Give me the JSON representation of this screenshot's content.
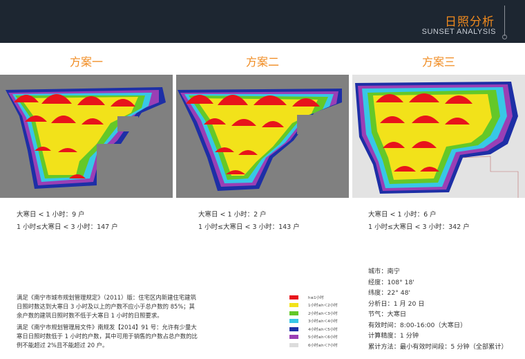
{
  "header": {
    "title": "日照分析",
    "subtitle": "SUNSET ANALYSIS"
  },
  "schemes": [
    {
      "title": "方案一",
      "stat_line1": "大寒日 < 1 小时：9 户",
      "stat_line2": "1 小时≤大寒日 < 3 小时：147 户"
    },
    {
      "title": "方案二",
      "stat_line1": "大寒日 < 1 小时：2 户",
      "stat_line2": "1 小时≤大寒日 < 3 小时：143 户"
    },
    {
      "title": "方案三",
      "stat_line1": "大寒日 < 1 小时：6 户",
      "stat_line2": "1 小时≤大寒日 < 3 小时：342 户"
    }
  ],
  "notes": {
    "para1": "满足《南宁市城市规划管理规定》（2011）版：住宅区内新建住宅建筑日照时数达到大寒日 3 小时及以上的户数不应小于总户数的 85%；其余户数的建筑日照时数不低于大寒日 1 小时的日照要求。",
    "para2": "满足《南宁市规划管理局文件》南规发【2014】91 号：允许有少量大寒日日照时数低于 1 小时的户数，其中可用于销售的户数占总户数的比例不能超过 2%且不能超过 20 户。"
  },
  "legend": [
    {
      "label": "h≤1小时",
      "color": "#e8141b"
    },
    {
      "label": "1小时≤h＜2小时",
      "color": "#f2e21a"
    },
    {
      "label": "2小时≤h＜3小时",
      "color": "#64c828"
    },
    {
      "label": "3小时≤h＜4小时",
      "color": "#38c7e6"
    },
    {
      "label": "4小时≤h＜5小时",
      "color": "#1d2fa6"
    },
    {
      "label": "5小时≤h＜6小时",
      "color": "#9a3fb5"
    },
    {
      "label": "6小时≤h＜7小时",
      "color": "#dcdcdc"
    }
  ],
  "info": {
    "city": "城市：南宁",
    "longitude": "经度：108° 18'",
    "latitude": "纬度：22° 48'",
    "date": "分析日：1 月 20 日",
    "solar_term": "节气：大寒日",
    "effective_time": "有效时间：8:00-16:00（大寒日）",
    "precision": "计算精度：1 分钟",
    "method": "累计方法：最小有效时间段：5 分钟（全部累计）"
  }
}
